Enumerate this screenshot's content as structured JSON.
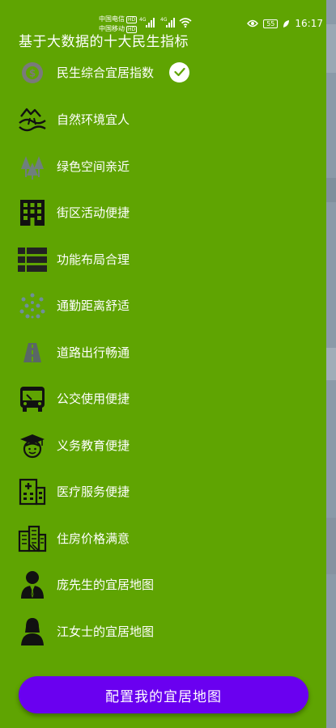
{
  "status_bar": {
    "carrier1": "中国电信",
    "carrier1_badge": "HD",
    "carrier2": "中国移动",
    "carrier2_badge": "HD",
    "network1": "4G",
    "network2": "4G",
    "battery": "55",
    "time": "16:17"
  },
  "drawer": {
    "title": "基于大数据的十大民生指标",
    "items": [
      {
        "label": "民生综合宜居指数",
        "icon": "livability-index-icon",
        "checked": true
      },
      {
        "label": "自然环境宜人",
        "icon": "nature-landscape-icon"
      },
      {
        "label": "绿色空间亲近",
        "icon": "trees-icon"
      },
      {
        "label": "街区活动便捷",
        "icon": "building-icon"
      },
      {
        "label": "功能布局合理",
        "icon": "list-layout-icon"
      },
      {
        "label": "通勤距离舒适",
        "icon": "commute-network-icon"
      },
      {
        "label": "道路出行畅通",
        "icon": "road-icon"
      },
      {
        "label": "公交使用便捷",
        "icon": "bus-icon"
      },
      {
        "label": "义务教育便捷",
        "icon": "graduate-icon"
      },
      {
        "label": "医疗服务便捷",
        "icon": "hospital-icon"
      },
      {
        "label": "住房价格满意",
        "icon": "housing-icon"
      },
      {
        "label": "庞先生的宜居地图",
        "icon": "man-avatar-icon"
      },
      {
        "label": "江女士的宜居地图",
        "icon": "woman-avatar-icon"
      }
    ],
    "cta_label": "配置我的宜居地图"
  },
  "colors": {
    "drawer_bg": "#5fa402",
    "cta_bg": "#6a00f0",
    "icon_dark": "#111111",
    "icon_grey": "#6f7f7c"
  }
}
